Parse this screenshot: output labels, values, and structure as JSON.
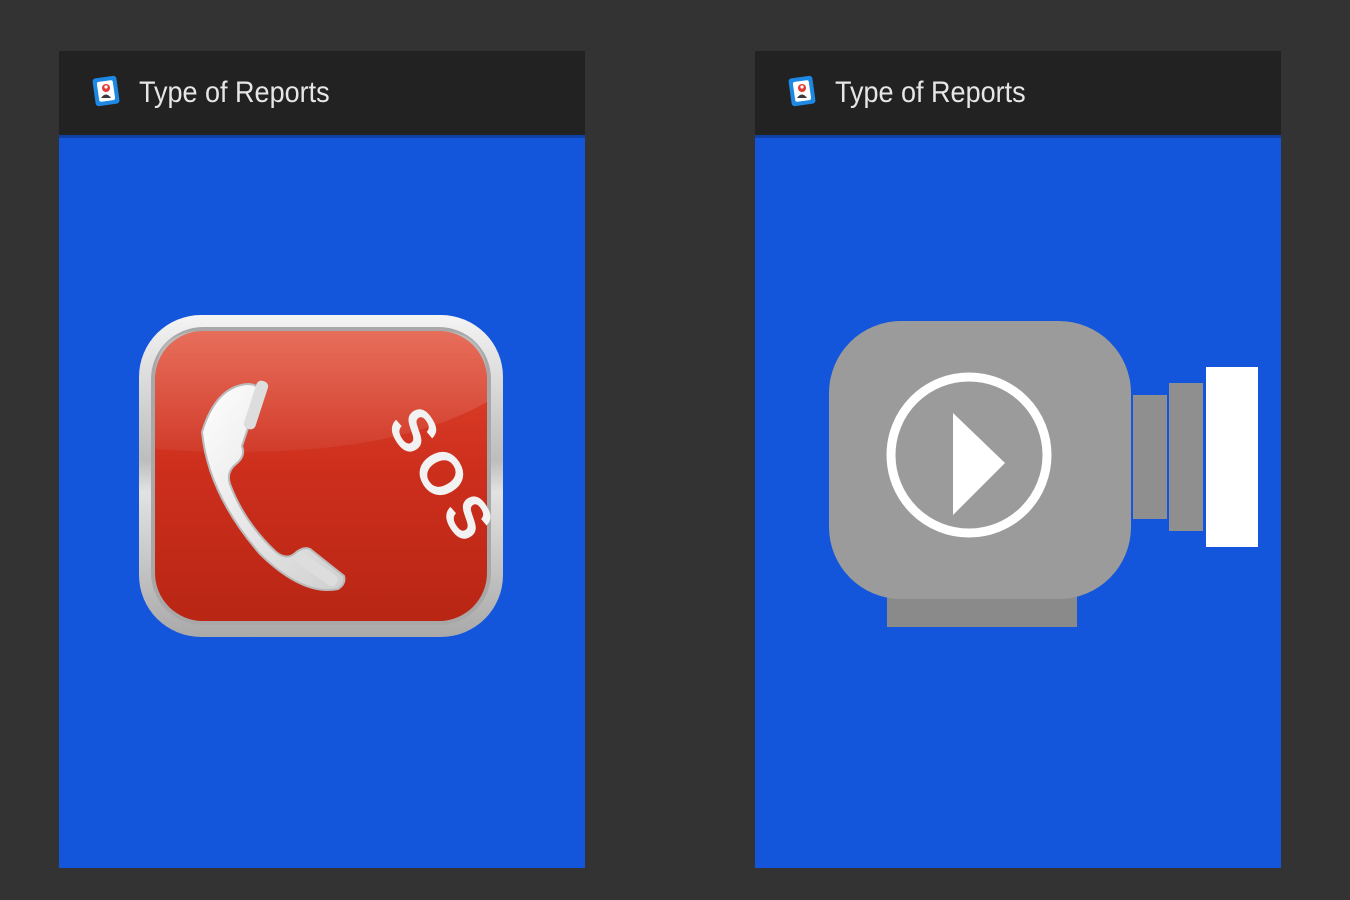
{
  "screens": [
    {
      "title": "Type of Reports",
      "app_icon": "app-logo-icon",
      "button": {
        "icon": "sos-phone-icon",
        "text": "SOS"
      }
    },
    {
      "title": "Type of Reports",
      "app_icon": "app-logo-icon",
      "button": {
        "icon": "video-camera-play-icon"
      }
    }
  ],
  "colors": {
    "page_background": "#333333",
    "screen_background": "#1456DB",
    "action_bar": "#222222",
    "title_text": "#E6E6E6",
    "sos_red": "#CF3220",
    "camera_gray": "#9B9B9B"
  }
}
